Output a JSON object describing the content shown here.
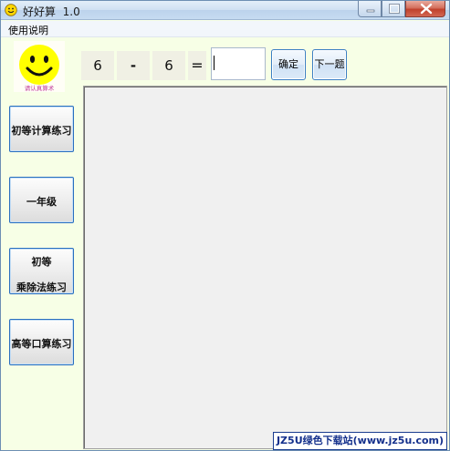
{
  "window": {
    "title": "好好算  1.0",
    "icon": "smiley-icon",
    "controls": [
      "minimize-icon",
      "maximize-icon",
      "close-icon"
    ]
  },
  "menu": {
    "items": [
      {
        "label": "使用说明"
      }
    ]
  },
  "logo": {
    "caption": "请认真算术",
    "face_color": "#ffff00"
  },
  "sidebar": {
    "buttons": [
      {
        "label": "初等计算练习"
      },
      {
        "label": "一年级"
      },
      {
        "line1": "初等",
        "line2": "乘除法练习"
      },
      {
        "label": "高等口算练习"
      }
    ]
  },
  "equation": {
    "operand1": "6",
    "operator": "-",
    "operand2": "6",
    "equals": "=",
    "answer_value": ""
  },
  "actions": {
    "confirm_label": "确定",
    "next_label": "下一题"
  },
  "watermark": {
    "text": "JZ5U绿色下载站(www.jz5u.com)"
  },
  "colors": {
    "window_bg": "#f7ffe6",
    "button_border": "#2a6fbf",
    "watermark_text": "#14308c"
  }
}
